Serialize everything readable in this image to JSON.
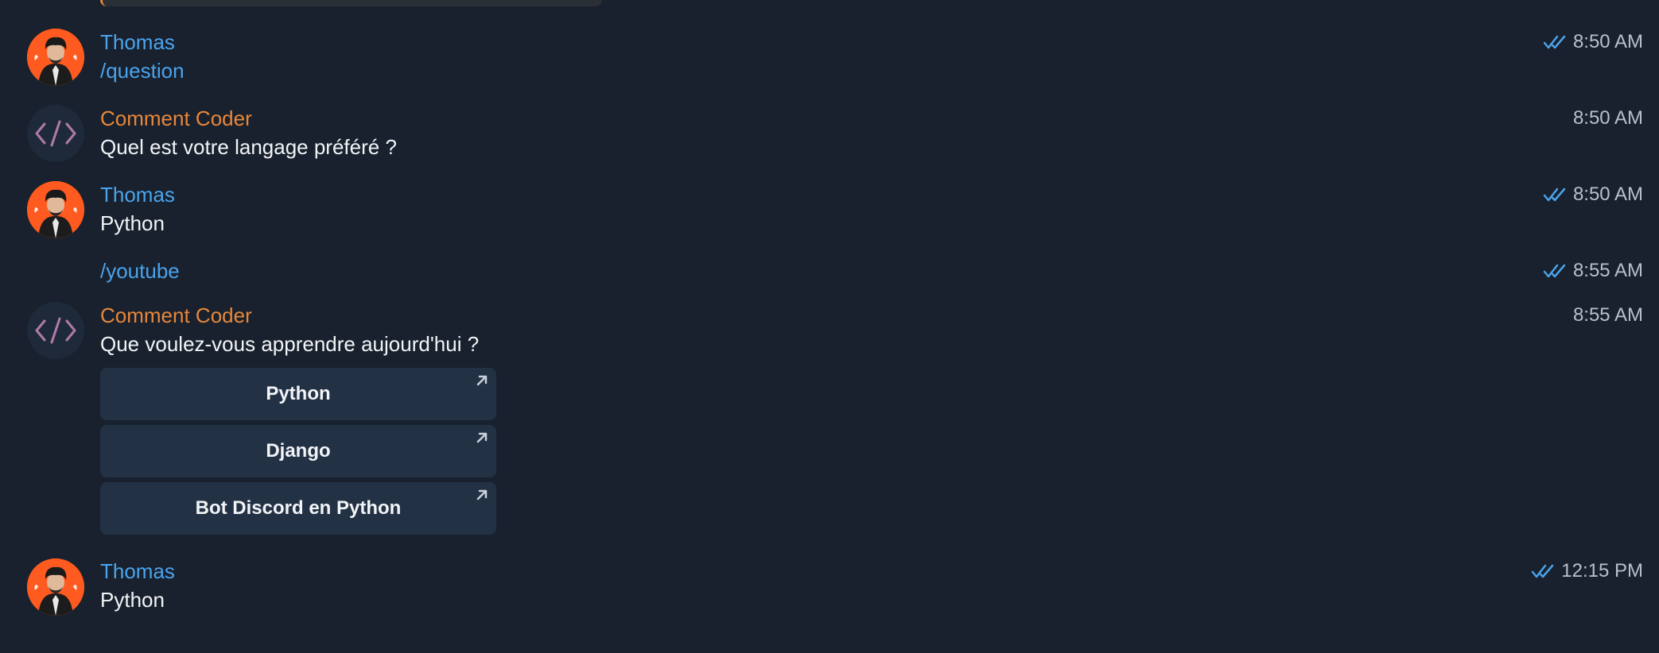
{
  "colors": {
    "background": "#18212d",
    "user_name": "#4ba3ec",
    "bot_name": "#e8873a",
    "command_text": "#4ba3ec",
    "read_check": "#4ba3ec",
    "button_bg": "#223144"
  },
  "messages": [
    {
      "sender": "Thomas",
      "text": "/question",
      "time": "8:50 AM"
    },
    {
      "sender": "Comment Coder",
      "text": "Quel est votre langage préféré ?",
      "time": "8:50 AM"
    },
    {
      "sender": "Thomas",
      "text": "Python",
      "time": "8:50 AM"
    },
    {
      "sender": "",
      "text": "/youtube",
      "time": "8:55 AM"
    },
    {
      "sender": "Comment Coder",
      "text": "Que voulez-vous apprendre aujourd'hui ?",
      "time": "8:55 AM"
    },
    {
      "sender": "Thomas",
      "text": "Python",
      "time": "12:15 PM"
    }
  ],
  "keyboard": {
    "buttons": [
      {
        "label": "Python",
        "icon": "external-link-arrow-icon"
      },
      {
        "label": "Django",
        "icon": "external-link-arrow-icon"
      },
      {
        "label": "Bot Discord en Python",
        "icon": "external-link-arrow-icon"
      }
    ]
  },
  "icons": {
    "user_avatar": "user-avatar-photo",
    "bot_avatar": "code-brackets-icon",
    "read_status": "double-check-icon"
  }
}
